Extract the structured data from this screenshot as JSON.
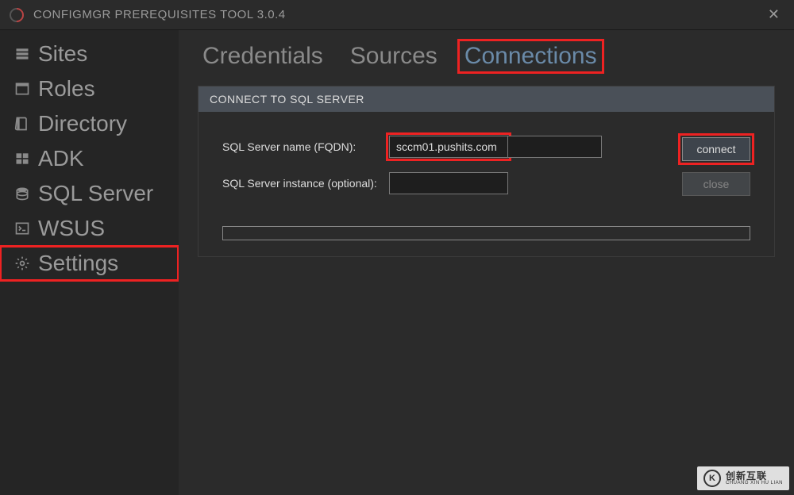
{
  "titlebar": {
    "title": "CONFIGMGR PREREQUISITES TOOL 3.0.4"
  },
  "sidebar": {
    "items": [
      {
        "label": "Sites",
        "icon": "server-icon"
      },
      {
        "label": "Roles",
        "icon": "panel-icon"
      },
      {
        "label": "Directory",
        "icon": "book-icon"
      },
      {
        "label": "ADK",
        "icon": "windows-icon"
      },
      {
        "label": "SQL Server",
        "icon": "database-icon"
      },
      {
        "label": "WSUS",
        "icon": "terminal-icon"
      },
      {
        "label": "Settings",
        "icon": "gear-icon"
      }
    ]
  },
  "tabs": {
    "credentials": "Credentials",
    "sources": "Sources",
    "connections": "Connections"
  },
  "panel": {
    "header": "CONNECT TO SQL SERVER",
    "fqdn_label": "SQL Server name (FQDN):",
    "fqdn_value": "sccm01.pushits.com",
    "instance_label": "SQL Server instance (optional):",
    "instance_value": "",
    "connect_label": "connect",
    "close_label": "close"
  },
  "watermark": {
    "brand": "创新互联",
    "sub": "CHUANG XIN HU LIAN"
  }
}
